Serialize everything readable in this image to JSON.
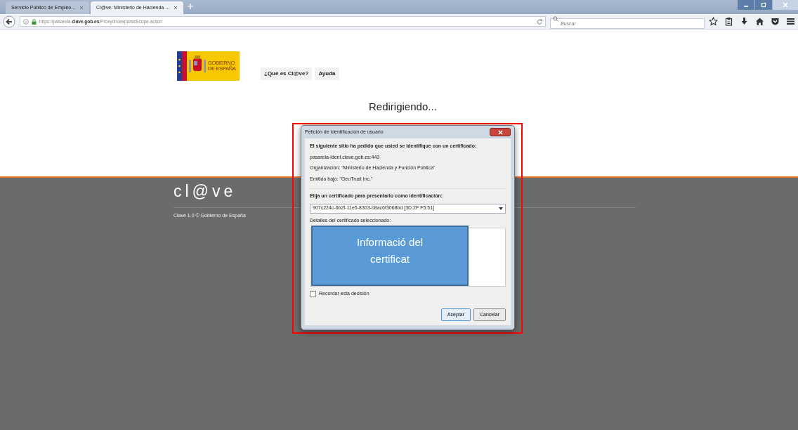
{
  "browser": {
    "tabs": [
      {
        "title": "Servicio Público de Empleo...",
        "selected": false
      },
      {
        "title": "Cl@ve: Ministerio de Hacienda ...",
        "selected": true
      }
    ],
    "url": {
      "prefix": "https://pasarela.",
      "domain": "clave.gob.es",
      "path": "/Proxy/indexparseScope.action"
    },
    "search": {
      "placeholder": "Buscar"
    }
  },
  "page": {
    "logo_text": "GOBIERNO DE ESPAÑA",
    "nav_buttons": [
      "¿Qué es Cl@ve?",
      "Ayuda"
    ],
    "status": "Redirigiendo...",
    "footer": {
      "brand": "cl@ve",
      "copyright": "Clave 1.0 © Gobierno de España"
    }
  },
  "dialog": {
    "title": "Petición de identificación de usuario",
    "intro": "El siguiente sitio ha pedido que usted se identifique con un certificado:",
    "site_lines": [
      "pasarela-ident.clave.gob.es:443",
      "Organización: \"Ministerio de Hacienda y Función Pública\"",
      "Emitido bajo: \"GeoTrust Inc.\""
    ],
    "choose_label": "Elija un certificado para presentarlo como identificación:",
    "certificate": "907c224c-6b2f-11e5-8303-b8ac6f3068bd [3D:2F:F5:51]",
    "details_label": "Detalles del certificado seleccionado:",
    "remember": {
      "label": "Recordar esta decisión",
      "checked": false
    },
    "buttons": [
      "Aceptar",
      "Cancelar"
    ]
  },
  "annotation": {
    "text": "Informació del certificat"
  }
}
